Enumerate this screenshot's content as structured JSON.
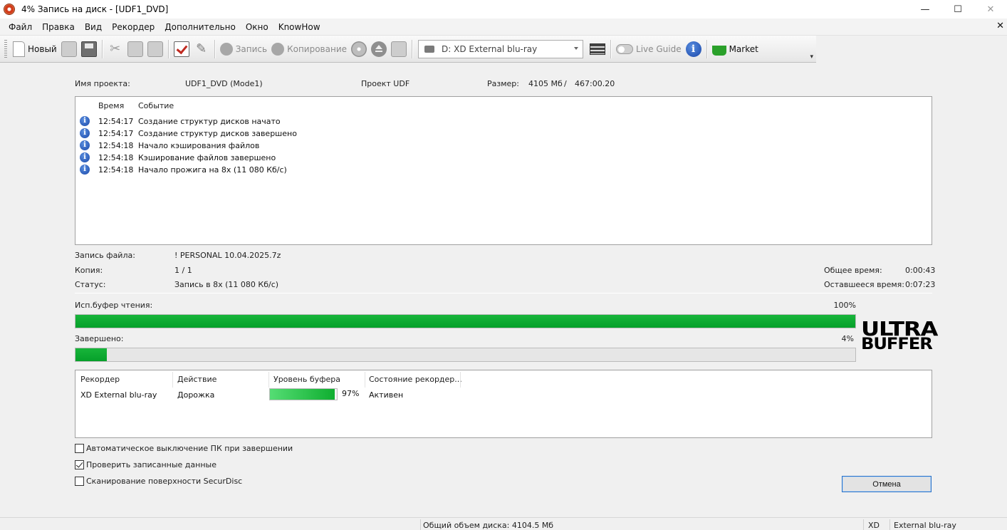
{
  "window": {
    "title": "4% Запись на диск - [UDF1_DVD]",
    "min_glyph": "—",
    "max_glyph": "☐",
    "close_glyph": "✕"
  },
  "menu": {
    "items": [
      "Файл",
      "Правка",
      "Вид",
      "Рекордер",
      "Дополнительно",
      "Окно",
      "KnowHow"
    ],
    "close_glyph": "✕"
  },
  "toolbar": {
    "new_label": "Новый",
    "burn_label": "Запись",
    "copy_label": "Копирование",
    "drive_value": "D: XD External blu-ray",
    "live_guide_label": "Live Guide",
    "market_label": "Market",
    "more_glyph": "▾"
  },
  "project": {
    "name_label": "Имя проекта:",
    "name_value": "UDF1_DVD (Mode1)",
    "type_value": "Проект UDF",
    "size_label": "Размер:",
    "size_mb": "4105 Мб",
    "size_sep": "/",
    "size_time": "467:00.20"
  },
  "log": {
    "columns": [
      "Время",
      "Событие"
    ],
    "icon_glyph": "i",
    "rows": [
      {
        "time": "12:54:17",
        "event": "Создание структур дисков начато"
      },
      {
        "time": "12:54:17",
        "event": "Создание структур дисков завершено"
      },
      {
        "time": "12:54:18",
        "event": "Начало кэширования файлов"
      },
      {
        "time": "12:54:18",
        "event": "Кэширование файлов завершено"
      },
      {
        "time": "12:54:18",
        "event": "Начало прожига на 8x (11 080 Кб/с)"
      }
    ]
  },
  "details": {
    "file_label": "Запись файла:",
    "file_value": "! PERSONAL 10.04.2025.7z",
    "copy_label": "Копия:",
    "copy_value": "1 / 1",
    "status_label": "Статус:",
    "status_value": "Запись в 8x (11 080 Кб/с)",
    "total_time_label": "Общее время:",
    "total_time_value": "0:00:43",
    "remaining_label": "Оставшееся время:",
    "remaining_value": "0:07:23"
  },
  "progress": {
    "read_buffer_label": "Исп.буфер чтения:",
    "read_buffer_text": "100%",
    "read_buffer_value": 100,
    "done_label": "Завершено:",
    "done_text": "4%",
    "done_value": 4
  },
  "logo": {
    "line1": "ULTRA",
    "line2": "BUFFER"
  },
  "recorders": {
    "columns": [
      "Рекордер",
      "Действие",
      "Уровень буфера",
      "Состояние рекордер..."
    ],
    "rows": [
      {
        "recorder": "XD External blu-ray",
        "action": "Дорожка",
        "buffer_text": "97%",
        "buffer_value": 97,
        "state": "Активен"
      }
    ]
  },
  "options": [
    {
      "label": "Автоматическое выключение ПК при завершении",
      "checked": false
    },
    {
      "label": "Проверить записанные данные",
      "checked": true
    },
    {
      "label": "Сканирование поверхности SecurDisc",
      "checked": false
    }
  ],
  "cancel_label": "Отмена",
  "statusbar": {
    "total": "Общий объем диска: 4104.5 Мб",
    "drive_letter": "XD",
    "drive_name": "External blu-ray"
  },
  "colors": {
    "progress_green": "#0aa62e",
    "focus_blue": "#2a72c8"
  }
}
